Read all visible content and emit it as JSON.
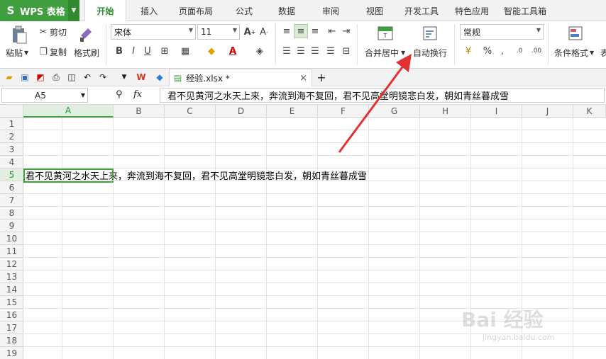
{
  "app": {
    "name": "WPS 表格",
    "logo": "S"
  },
  "tabs": [
    "开始",
    "插入",
    "页面布局",
    "公式",
    "数据",
    "审阅",
    "视图",
    "开发工具",
    "特色应用",
    "智能工具箱"
  ],
  "ribbon": {
    "paste": "粘贴",
    "cut": "剪切",
    "copy": "复制",
    "format_painter": "格式刷",
    "font_name": "宋体",
    "font_size": "11",
    "merge_center": "合并居中",
    "wrap_text": "自动换行",
    "number_format": "常规",
    "conditional_format": "条件格式",
    "more": "表"
  },
  "quickbar": {
    "doc_tab": "经验.xlsx *",
    "close": "×",
    "add": "+"
  },
  "formula_bar": {
    "name_box": "A5",
    "fx": "fx",
    "content": "君不见黄河之水天上来，奔流到海不复回，君不见高堂明镜悲白发，朝如青丝暮成雪"
  },
  "columns": [
    "A",
    "B",
    "C",
    "D",
    "E",
    "F",
    "G",
    "H",
    "I",
    "J",
    "K"
  ],
  "rows": [
    "1",
    "2",
    "3",
    "4",
    "5",
    "6",
    "7",
    "8",
    "9",
    "10",
    "11",
    "12",
    "13",
    "14",
    "15",
    "16",
    "17",
    "18",
    "19"
  ],
  "cell_A5": "君不见黄河之水天上来，奔流到海不复回，君不见高堂明镜悲白发，朝如青丝暮成雪",
  "watermark": {
    "main": "Bai 经验",
    "sub": "jingyan.baidu.com"
  }
}
